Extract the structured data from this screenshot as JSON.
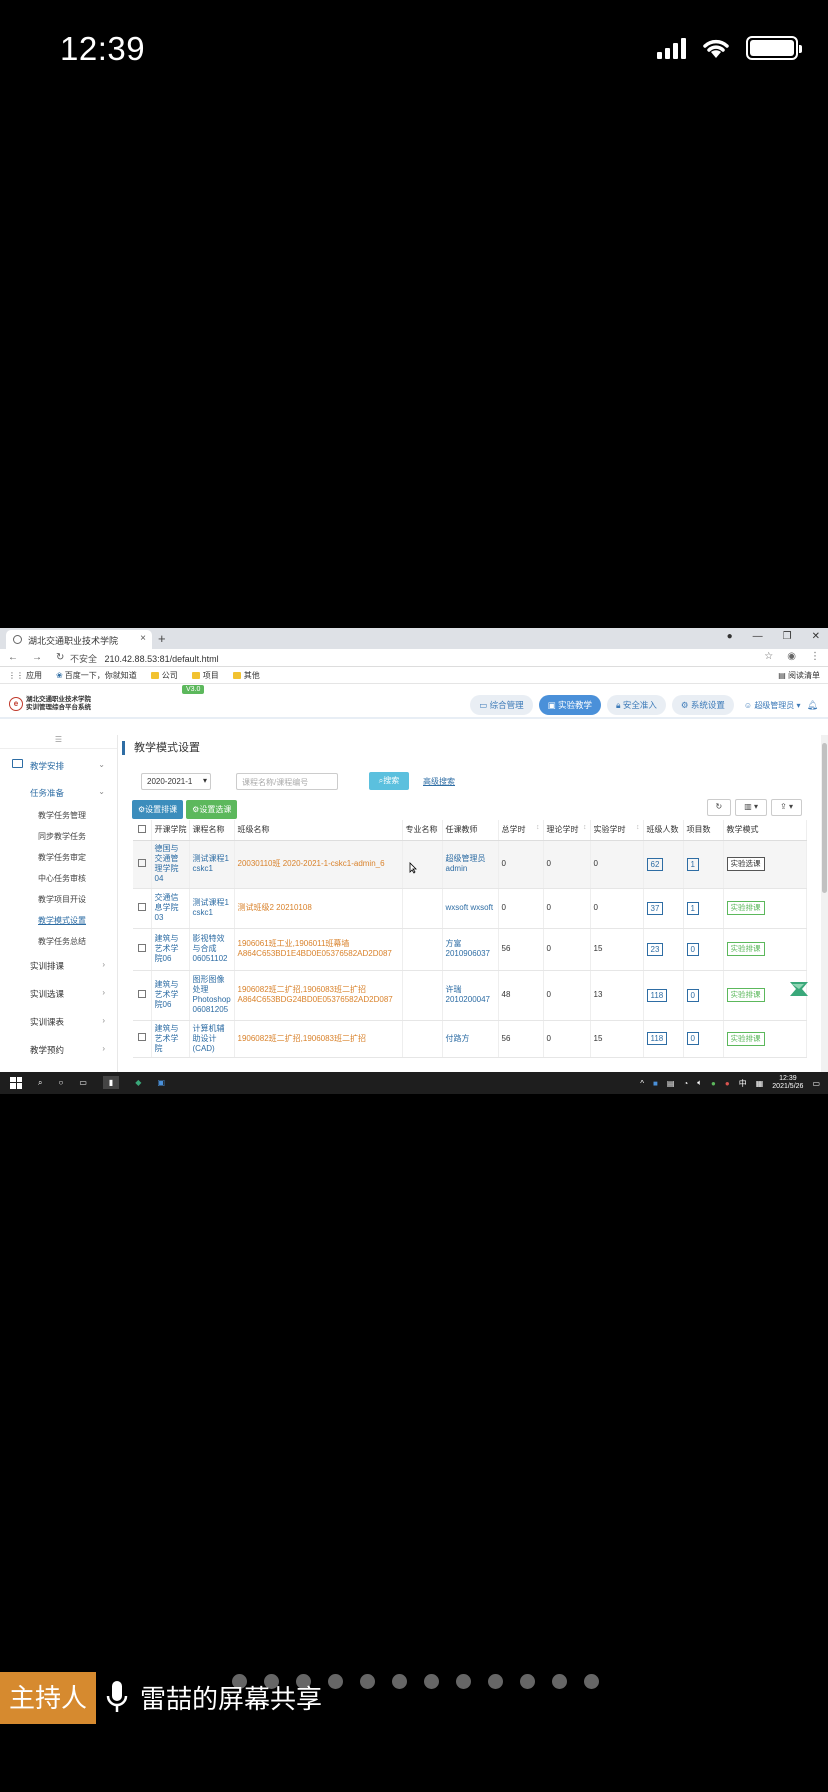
{
  "phone": {
    "time": "12:39"
  },
  "browser": {
    "tab_title": "湖北交通职业技术学院",
    "url_insecure": "不安全",
    "url": "210.42.88.53:81/default.html",
    "bookmarks": [
      "应用",
      "百度一下，你就知道",
      "公司",
      "项目",
      "其他"
    ],
    "reading_list": "阅读清单"
  },
  "app": {
    "logo_line1": "湖北交通职业技术学院",
    "logo_line2": "实训管理综合平台系统",
    "version": "V3.0",
    "nav": [
      "综合管理",
      "实验教学",
      "安全准入",
      "系统设置"
    ],
    "user": "超级管理员"
  },
  "sidebar": {
    "top": "☰",
    "group": "教学安排",
    "sub_group": "任务准备",
    "items": [
      "教学任务管理",
      "同步教学任务",
      "教学任务审定",
      "中心任务审核",
      "教学项目开设",
      "教学模式设置",
      "教学任务总结"
    ],
    "active_item": "教学模式设置",
    "others": [
      "实训排课",
      "实训选课",
      "实训课表",
      "教学预约"
    ]
  },
  "main": {
    "title": "教学模式设置",
    "year_select": "2020-2021-1",
    "search_placeholder": "课程名称/课程编号",
    "search_btn": "搜索",
    "advanced": "高级搜索",
    "btn_set_schedule": "设置排课",
    "btn_set_selection": "设置选课"
  },
  "table": {
    "headers": [
      "开课学院",
      "课程名称",
      "班级名称",
      "专业名称",
      "任课教师",
      "总学时",
      "理论学时",
      "实验学时",
      "班级人数",
      "项目数",
      "教学模式"
    ],
    "rows": [
      {
        "college": "德国与交通管理学院04",
        "course": "测试课程1 cskc1",
        "class": "20030110班 2020-2021-1-cskc1-admin_6",
        "major": "",
        "teacher": "超级管理员 admin",
        "total": "0",
        "theory": "0",
        "exp": "0",
        "size": "62",
        "projects": "1",
        "mode": "实验选课",
        "mode_style": "dark"
      },
      {
        "college": "交通信息学院03",
        "course": "测试课程1 cskc1",
        "class": "测试班级2 20210108",
        "major": "",
        "teacher": "wxsoft wxsoft",
        "total": "0",
        "theory": "0",
        "exp": "0",
        "size": "37",
        "projects": "1",
        "mode": "实验排课",
        "mode_style": "green"
      },
      {
        "college": "建筑与艺术学院06",
        "course": "影视特效与合成 06051102",
        "class": "1906061班工业,1906011班幕墙 A864C653BD1E4BD0E05376582AD2D087",
        "major": "",
        "teacher": "方富 2010906037",
        "total": "56",
        "theory": "0",
        "exp": "15",
        "size": "23",
        "projects": "0",
        "mode": "实验排课",
        "mode_style": "green"
      },
      {
        "college": "建筑与艺术学院06",
        "course": "图形图像处理 Photoshop 06081205",
        "class": "1906082班二扩招,1906083班二扩招 A864C653BDG24BD0E05376582AD2D087",
        "major": "",
        "teacher": "许瑞 2010200047",
        "total": "48",
        "theory": "0",
        "exp": "13",
        "size": "118",
        "projects": "0",
        "mode": "实验排课",
        "mode_style": "green"
      },
      {
        "college": "建筑与艺术学院",
        "course": "计算机辅助设计(CAD)",
        "class": "1906082班二扩招,1906083班二扩招",
        "major": "",
        "teacher": "付路方",
        "total": "56",
        "theory": "0",
        "exp": "15",
        "size": "118",
        "projects": "0",
        "mode": "实验排课",
        "mode_style": "green"
      }
    ]
  },
  "taskbar": {
    "time": "12:39",
    "date": "2021/5/26",
    "ime": "中"
  },
  "meeting": {
    "host": "主持人",
    "share_text": "雷喆的屏幕共享",
    "page_dots": 12
  },
  "colors": {
    "primary": "#2e6da4",
    "accent_orange": "#d68a2f",
    "green": "#5cb85c"
  }
}
